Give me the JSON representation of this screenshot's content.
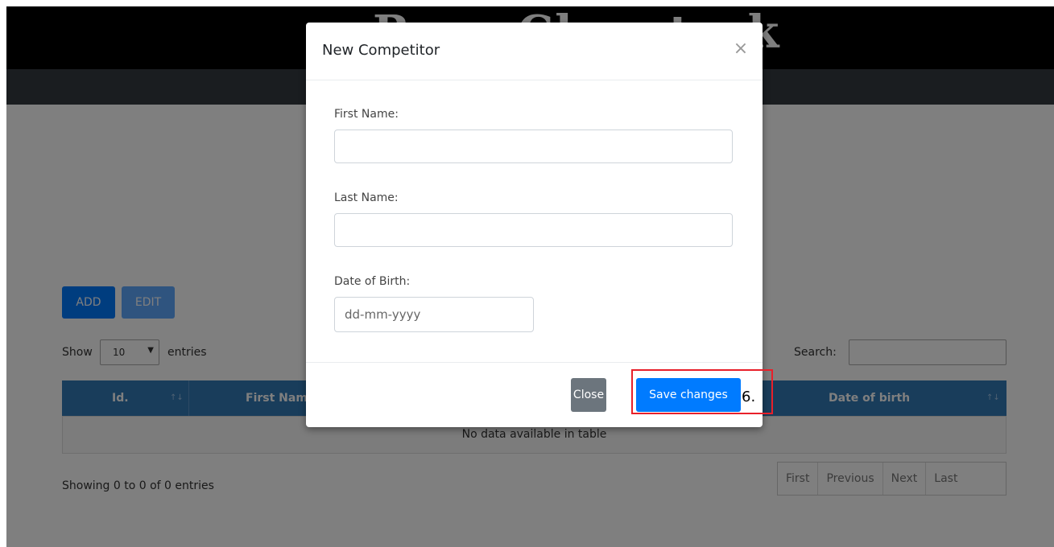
{
  "header": {
    "site_title": "Russ Chemtrak"
  },
  "toolbar": {
    "add_label": "ADD",
    "edit_label": "EDIT"
  },
  "table_controls": {
    "show_label": "Show",
    "length_value": "10",
    "entries_label": "entries",
    "search_label": "Search:",
    "search_value": ""
  },
  "table": {
    "columns": [
      "Id.",
      "First Name",
      "Date of birth"
    ],
    "empty_message": "No data available in table",
    "info": "Showing 0 to 0 of 0 entries",
    "pagination": [
      "First",
      "Previous",
      "Next",
      "Last"
    ]
  },
  "modal": {
    "title": "New Competitor",
    "close_x": "×",
    "fields": {
      "first_name_label": "First Name:",
      "first_name_value": "",
      "last_name_label": "Last Name:",
      "last_name_value": "",
      "dob_label": "Date of Birth:",
      "dob_placeholder": "dd-mm-yyyy"
    },
    "close_label": "Close",
    "save_label": "Save changes"
  },
  "annotation": {
    "step_label": "6.",
    "highlight_color": "#e8202a"
  },
  "colors": {
    "primary": "#007bff",
    "table_header": "#337ab7",
    "secondary": "#6c757d"
  }
}
